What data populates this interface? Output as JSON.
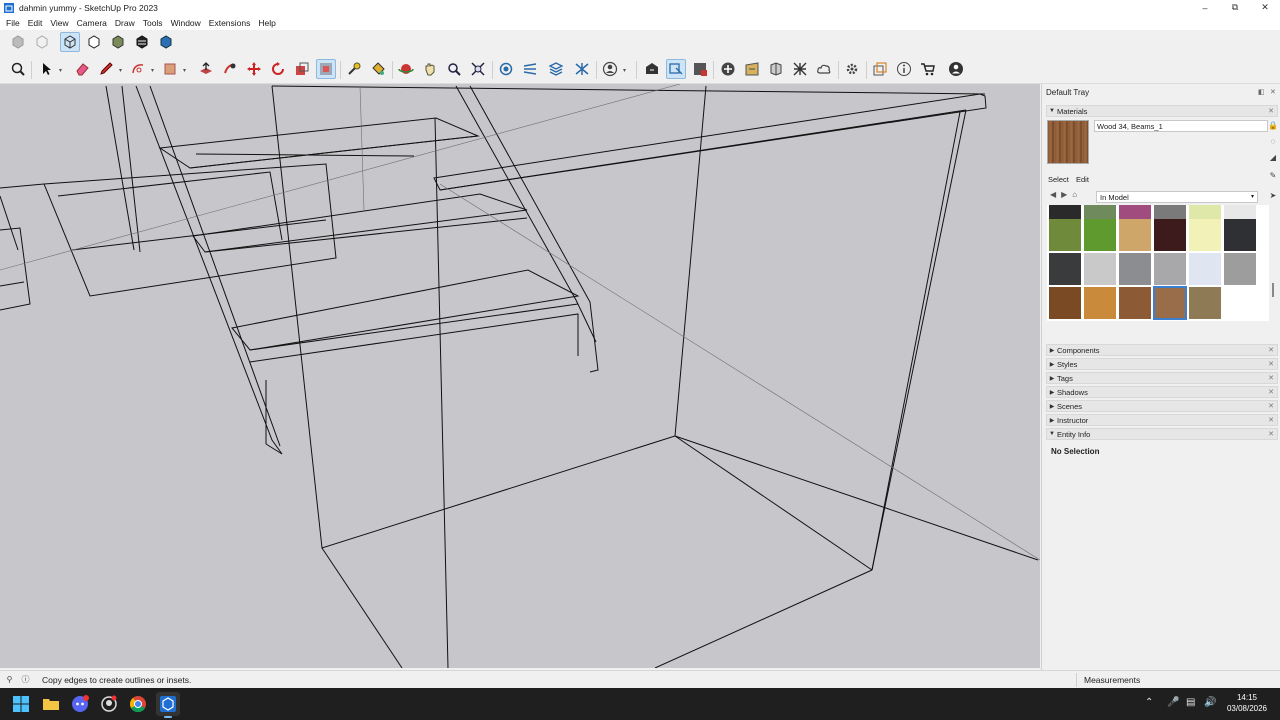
{
  "window": {
    "title": "dahmin yummy - SketchUp Pro 2023",
    "controls": [
      "minimize-icon",
      "restore-icon",
      "close-icon"
    ]
  },
  "menu": [
    "File",
    "Edit",
    "View",
    "Camera",
    "Draw",
    "Tools",
    "Window",
    "Extensions",
    "Help"
  ],
  "toolbar_top": {
    "buttons": [
      "x-ray-style-icon",
      "back-edges-style-icon",
      "wireframe-style-icon",
      "hidden-line-style-icon",
      "shaded-style-icon",
      "shaded-textures-style-icon",
      "monochrome-style-icon"
    ],
    "active": "wireframe-style-icon"
  },
  "toolbar_main": {
    "buttons": [
      "zoom-icon",
      "select-icon",
      "eraser-icon",
      "pencil-icon",
      "arc-icon",
      "rectangle-icon",
      "push-pull-icon",
      "follow-me-icon",
      "move-icon",
      "rotate-icon",
      "scale-icon",
      "offset-icon",
      "tape-measure-icon",
      "paint-bucket-icon",
      "orbit-icon",
      "pan-icon",
      "zoom-window-icon",
      "zoom-extents-icon",
      "section-plane-icon",
      "sandbox-icon",
      "solid-tools-icon",
      "advanced-camera-icon",
      "account-icon",
      "warehouse-icon",
      "extension-warehouse-icon",
      "layout-icon",
      "add-location-icon",
      "geo-location-icon",
      "photo-texture-icon",
      "trimble-connect-icon",
      "preferences-icon",
      "components-icon",
      "info-icon",
      "cart-icon",
      "profile-icon"
    ],
    "active": [
      "offset-icon",
      "layout-icon"
    ]
  },
  "tray": {
    "title": "Default Tray",
    "materials": {
      "header": "Materials",
      "current_material": "Wood 34, Beams_1",
      "tabs": [
        "Select",
        "Edit"
      ],
      "collection": "In Model",
      "swatches": [
        {
          "color": "#2a2a2a",
          "row": 0
        },
        {
          "color": "#6f8a5c",
          "row": 0
        },
        {
          "color": "#a04c7e",
          "row": 0
        },
        {
          "color": "#7a7a7a",
          "row": 0
        },
        {
          "color": "#dfe8a8",
          "row": 0
        },
        {
          "color": "#e8e8e8",
          "row": 0
        },
        {
          "color": "#6e8a3a",
          "row": 1
        },
        {
          "color": "#5f9a2e",
          "row": 1
        },
        {
          "color": "#cfa66a",
          "row": 1
        },
        {
          "color": "#3d1a1c",
          "row": 1
        },
        {
          "color": "#f2f2b8",
          "row": 1
        },
        {
          "color": "#2e3033",
          "row": 1
        },
        {
          "color": "#3a3b3d",
          "row": 2
        },
        {
          "color": "#c9c9c9",
          "row": 2
        },
        {
          "color": "#8b8d90",
          "row": 2
        },
        {
          "color": "#a8a8aa",
          "row": 2
        },
        {
          "color": "#dfe6f2",
          "row": 2
        },
        {
          "color": "#9d9d9d",
          "row": 2
        },
        {
          "color": "#7a4a25",
          "row": 3
        },
        {
          "color": "#c98a3c",
          "row": 3
        },
        {
          "color": "#8c5a34",
          "row": 3
        },
        {
          "color": "#9a6d4a",
          "row": 3
        },
        {
          "color": "#8e7a55",
          "row": 3
        }
      ],
      "selected_swatch": 21
    },
    "panels": [
      "Components",
      "Styles",
      "Tags",
      "Shadows",
      "Scenes",
      "Instructor",
      "Entity Info"
    ],
    "entity_info": "No Selection"
  },
  "status": {
    "hint": "Copy edges to create outlines or insets.",
    "measurements_label": "Measurements"
  },
  "taskbar": {
    "apps": [
      "windows-start-icon",
      "file-explorer-icon",
      "discord-icon",
      "github-icon",
      "chrome-icon",
      "sketchup-icon"
    ],
    "active_app": "sketchup-icon",
    "time": "14:15",
    "date": "03/08/2026"
  }
}
